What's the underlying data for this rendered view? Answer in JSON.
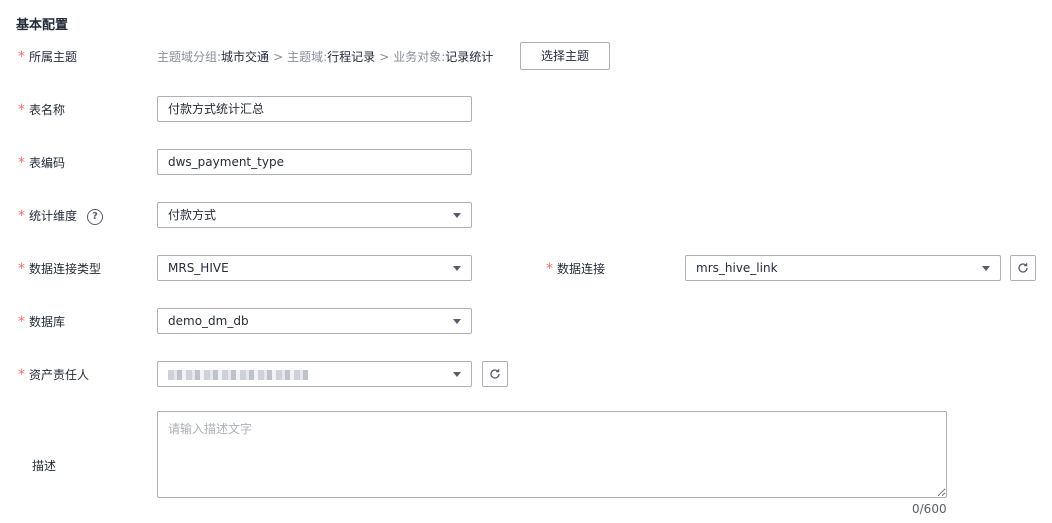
{
  "section_title": "基本配置",
  "theme": {
    "label": "所属主题",
    "group_key": "主题域分组:",
    "group_val": "城市交通",
    "domain_key": "主题域:",
    "domain_val": "行程记录",
    "object_key": "业务对象:",
    "object_val": "记录统计",
    "sep": ">",
    "select_button": "选择主题"
  },
  "table_name": {
    "label": "表名称",
    "value": "付款方式统计汇总"
  },
  "table_code": {
    "label": "表编码",
    "value": "dws_payment_type"
  },
  "dimension": {
    "label": "统计维度",
    "help": "?",
    "value": "付款方式"
  },
  "conn_type": {
    "label": "数据连接类型",
    "value": "MRS_HIVE"
  },
  "connection": {
    "label": "数据连接",
    "value": "mrs_hive_link"
  },
  "database": {
    "label": "数据库",
    "value": "demo_dm_db"
  },
  "owner": {
    "label": "资产责任人"
  },
  "description": {
    "label": "描述",
    "placeholder": "请输入描述文字",
    "counter": "0/600"
  },
  "required_mark": "*"
}
